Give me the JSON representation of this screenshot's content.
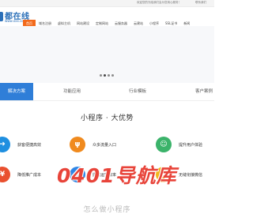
{
  "topbar": {
    "notice": "欢迎您的光临我们会为您用心服务！",
    "link": "联系我们"
  },
  "logo": {
    "text": "都在线",
    "sub": "www.xxx.com"
  },
  "nav": {
    "items": [
      "首页",
      "域名注册",
      "虚拟主机",
      "网站建设",
      "定制网站",
      "云服务器",
      "云建站",
      "小程序",
      "SSL证书",
      "新闻"
    ],
    "active_index": 0
  },
  "banner": {
    "slides": 4,
    "active_slide": 2
  },
  "tabs": {
    "items": [
      "解决方案",
      "功能应用",
      "行业模板",
      "客户案例"
    ],
    "active_index": 0
  },
  "section": {
    "title": "小程序 · 大优势"
  },
  "features": [
    {
      "label": "获客便捷高效",
      "icon": "arrow-icon",
      "color": "#1f8fe0"
    },
    {
      "label": "众多流量入口",
      "icon": "fork-icon",
      "color": "#f08a1e"
    },
    {
      "label": "提升用户体验",
      "icon": "user-icon",
      "color": "#3bb36a"
    },
    {
      "label": "降低推广成本",
      "icon": "coin-icon",
      "color": "#e9502f"
    },
    {
      "label": "提高运营效率",
      "icon": "document-icon",
      "color": "#2f86e6"
    },
    {
      "label": "无缝衔接微信",
      "icon": "link-icon",
      "color": "#f2b61b"
    }
  ],
  "watermark": "0401导航库",
  "footer_cut": "怎么做小程序"
}
